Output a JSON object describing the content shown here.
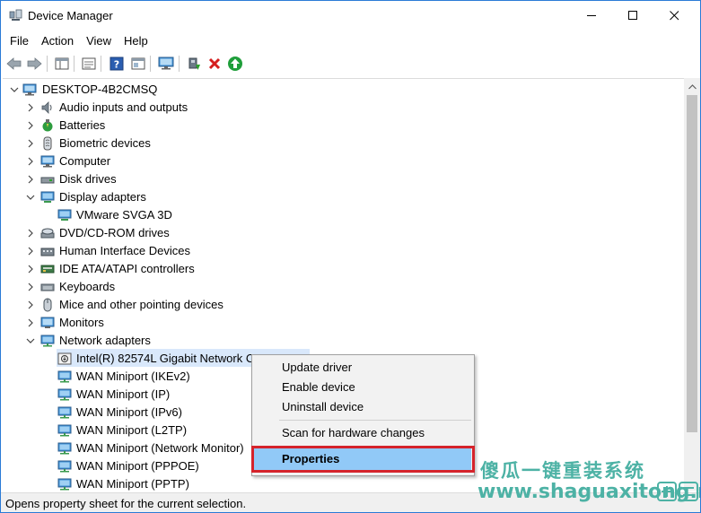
{
  "window": {
    "title": "Device Manager",
    "controls": [
      "minimize",
      "maximize",
      "close"
    ]
  },
  "menubar": {
    "items": [
      "File",
      "Action",
      "View",
      "Help"
    ]
  },
  "toolbar": {
    "buttons": [
      "back-icon",
      "forward-icon",
      "show-hide-tree-icon",
      "properties-icon",
      "help-icon",
      "view-icon",
      "monitor-icon",
      "update-driver-icon",
      "uninstall-icon",
      "enable-icon"
    ]
  },
  "tree": {
    "root": "DESKTOP-4B2CMSQ",
    "categories": [
      {
        "label": "Audio inputs and outputs",
        "icon": "speaker-icon",
        "expanded": false
      },
      {
        "label": "Batteries",
        "icon": "battery-icon",
        "expanded": false
      },
      {
        "label": "Biometric devices",
        "icon": "biometric-icon",
        "expanded": false
      },
      {
        "label": "Computer",
        "icon": "computer-icon",
        "expanded": false
      },
      {
        "label": "Disk drives",
        "icon": "disk-drive-icon",
        "expanded": false
      },
      {
        "label": "Display adapters",
        "icon": "display-adapter-icon",
        "expanded": true
      },
      {
        "label": "VMware SVGA 3D",
        "icon": "display-adapter-icon",
        "child": true
      },
      {
        "label": "DVD/CD-ROM drives",
        "icon": "dvd-icon",
        "expanded": false
      },
      {
        "label": "Human Interface Devices",
        "icon": "hid-icon",
        "expanded": false
      },
      {
        "label": "IDE ATA/ATAPI controllers",
        "icon": "ide-icon",
        "expanded": false
      },
      {
        "label": "Keyboards",
        "icon": "keyboard-icon",
        "expanded": false
      },
      {
        "label": "Mice and other pointing devices",
        "icon": "mouse-icon",
        "expanded": false
      },
      {
        "label": "Monitors",
        "icon": "monitor-icon",
        "expanded": false
      },
      {
        "label": "Network adapters",
        "icon": "network-icon",
        "expanded": true
      },
      {
        "label": "Intel(R) 82574L Gigabit Network C",
        "icon": "network-adapter-icon",
        "child": true,
        "selected": true
      },
      {
        "label": "WAN Miniport (IKEv2)",
        "icon": "network-adapter-icon",
        "child": true
      },
      {
        "label": "WAN Miniport (IP)",
        "icon": "network-adapter-icon",
        "child": true
      },
      {
        "label": "WAN Miniport (IPv6)",
        "icon": "network-adapter-icon",
        "child": true
      },
      {
        "label": "WAN Miniport (L2TP)",
        "icon": "network-adapter-icon",
        "child": true
      },
      {
        "label": "WAN Miniport (Network Monitor)",
        "icon": "network-adapter-icon",
        "child": true
      },
      {
        "label": "WAN Miniport (PPPOE)",
        "icon": "network-adapter-icon",
        "child": true
      },
      {
        "label": "WAN Miniport (PPTP)",
        "icon": "network-adapter-icon",
        "child": true
      }
    ]
  },
  "context_menu": {
    "items": [
      "Update driver",
      "Enable device",
      "Uninstall device",
      "Scan for hardware changes",
      "Properties"
    ],
    "highlighted": "Properties"
  },
  "statusbar": {
    "text": "Opens property sheet for the current selection."
  },
  "watermark": {
    "chinese": "傻瓜一键重装系统",
    "url": "www.shaguaxitong.net"
  },
  "colors": {
    "window_border": "#2b7bd6",
    "selection": "#d9e8fb",
    "menu_highlight": "#91c9f7",
    "callout_red": "#d5232b",
    "watermark": "#4db2a5"
  }
}
